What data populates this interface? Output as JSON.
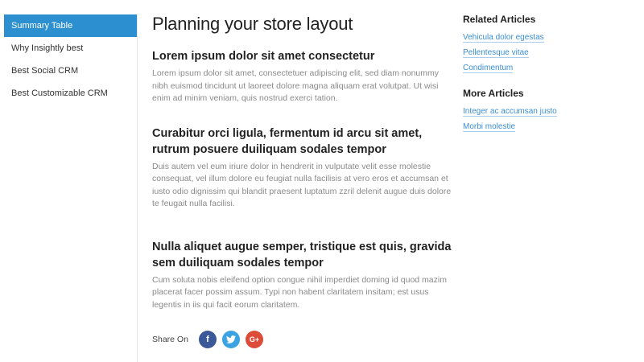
{
  "sidebar": {
    "items": [
      {
        "label": "Summary Table",
        "active": true
      },
      {
        "label": "Why Insightly best"
      },
      {
        "label": "Best Social CRM"
      },
      {
        "label": "Best Customizable CRM"
      }
    ]
  },
  "main": {
    "title": "Planning your store layout",
    "sections": [
      {
        "heading": "Lorem ipsum dolor sit amet consectetur",
        "body": "Lorem ipsum dolor sit amet, consectetuer adipiscing elit, sed diam nonummy nibh euismod tincidunt ut laoreet dolore magna aliquam erat volutpat. Ut wisi enim ad minim veniam, quis nostrud exerci tation."
      },
      {
        "heading": "Curabitur orci ligula, fermentum id arcu sit amet, rutrum posuere duiliquam sodales tempor",
        "body": "Duis autem vel eum iriure dolor in hendrerit in vulputate velit esse molestie consequat, vel illum dolore eu feugiat nulla facilisis at vero eros et accumsan et iusto odio dignissim qui blandit praesent luptatum zzril delenit augue duis dolore te feugait nulla facilisi."
      },
      {
        "heading": "Nulla aliquet augue semper, tristique est quis, gravida sem duiliquam sodales tempor",
        "body": "Cum soluta nobis eleifend option congue nihil imperdiet doming id quod mazim placerat facer possim assum. Typi non habent claritatem insitam; est usus legentis in iis qui facit eorum claritatem."
      }
    ],
    "share": {
      "label": "Share On",
      "icons": {
        "facebook": "f",
        "twitter": "t",
        "google_plus": "G+"
      }
    }
  },
  "right": {
    "related": {
      "title": "Related Articles",
      "links": [
        "Vehicula dolor egestas",
        "Pellentesque vitae",
        "Condimentum"
      ]
    },
    "more": {
      "title": "More Articles",
      "links": [
        "Integer ac accumsan justo",
        "Morbi molestie"
      ]
    }
  },
  "colors": {
    "accent": "#2b8fd0",
    "link": "#3a8ed3",
    "facebook": "#3b5998",
    "twitter": "#3ca3e2",
    "google_plus": "#dd4b39"
  }
}
